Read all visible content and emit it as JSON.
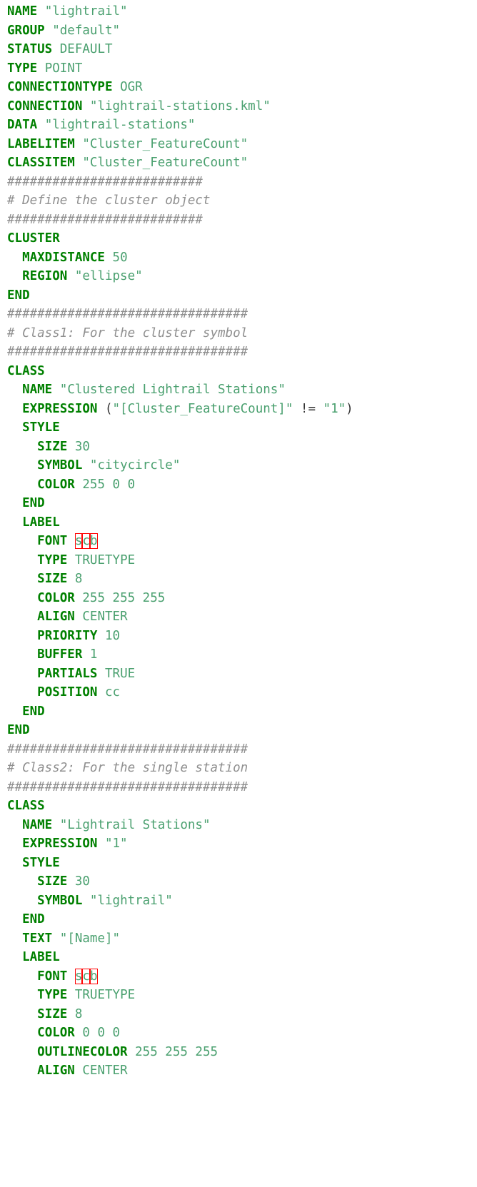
{
  "indent_unit": "  ",
  "lines": [
    {
      "indent": 0,
      "parts": [
        {
          "t": "NAME",
          "c": "kw"
        },
        {
          "t": " "
        },
        {
          "t": "\"lightrail\"",
          "c": "str"
        }
      ]
    },
    {
      "indent": 0,
      "parts": [
        {
          "t": "GROUP",
          "c": "kw"
        },
        {
          "t": " "
        },
        {
          "t": "\"default\"",
          "c": "str"
        }
      ]
    },
    {
      "indent": 0,
      "parts": [
        {
          "t": "STATUS",
          "c": "kw"
        },
        {
          "t": " "
        },
        {
          "t": "DEFAULT",
          "c": "val"
        }
      ]
    },
    {
      "indent": 0,
      "parts": [
        {
          "t": "TYPE",
          "c": "kw"
        },
        {
          "t": " "
        },
        {
          "t": "POINT",
          "c": "val"
        }
      ]
    },
    {
      "indent": 0,
      "parts": [
        {
          "t": "CONNECTIONTYPE",
          "c": "kw"
        },
        {
          "t": " "
        },
        {
          "t": "OGR",
          "c": "val"
        }
      ]
    },
    {
      "indent": 0,
      "parts": [
        {
          "t": "CONNECTION",
          "c": "kw"
        },
        {
          "t": " "
        },
        {
          "t": "\"lightrail-stations.kml\"",
          "c": "str"
        }
      ]
    },
    {
      "indent": 0,
      "parts": [
        {
          "t": "DATA",
          "c": "kw"
        },
        {
          "t": " "
        },
        {
          "t": "\"lightrail-stations\"",
          "c": "str"
        }
      ]
    },
    {
      "indent": 0,
      "parts": [
        {
          "t": "LABELITEM",
          "c": "kw"
        },
        {
          "t": " "
        },
        {
          "t": "\"Cluster_FeatureCount\"",
          "c": "str"
        }
      ]
    },
    {
      "indent": 0,
      "parts": [
        {
          "t": "CLASSITEM",
          "c": "kw"
        },
        {
          "t": " "
        },
        {
          "t": "\"Cluster_FeatureCount\"",
          "c": "str"
        }
      ]
    },
    {
      "indent": 0,
      "parts": [
        {
          "t": "##########################",
          "c": "cm"
        }
      ]
    },
    {
      "indent": 0,
      "parts": [
        {
          "t": "# Define the cluster object",
          "c": "cm"
        }
      ]
    },
    {
      "indent": 0,
      "parts": [
        {
          "t": "##########################",
          "c": "cm"
        }
      ]
    },
    {
      "indent": 0,
      "parts": [
        {
          "t": "CLUSTER",
          "c": "kw"
        }
      ]
    },
    {
      "indent": 1,
      "parts": [
        {
          "t": "MAXDISTANCE",
          "c": "kw"
        },
        {
          "t": " "
        },
        {
          "t": "50",
          "c": "val"
        }
      ]
    },
    {
      "indent": 1,
      "parts": [
        {
          "t": "REGION",
          "c": "kw"
        },
        {
          "t": " "
        },
        {
          "t": "\"ellipse\"",
          "c": "str"
        }
      ]
    },
    {
      "indent": 0,
      "parts": [
        {
          "t": "END",
          "c": "kw"
        }
      ]
    },
    {
      "indent": 0,
      "parts": [
        {
          "t": "################################",
          "c": "cm"
        }
      ]
    },
    {
      "indent": 0,
      "parts": [
        {
          "t": "# Class1: For the cluster symbol",
          "c": "cm"
        }
      ]
    },
    {
      "indent": 0,
      "parts": [
        {
          "t": "################################",
          "c": "cm"
        }
      ]
    },
    {
      "indent": 0,
      "parts": [
        {
          "t": "CLASS",
          "c": "kw"
        }
      ]
    },
    {
      "indent": 1,
      "parts": [
        {
          "t": "NAME",
          "c": "kw"
        },
        {
          "t": " "
        },
        {
          "t": "\"Clustered Lightrail Stations\"",
          "c": "str"
        }
      ]
    },
    {
      "indent": 1,
      "parts": [
        {
          "t": "EXPRESSION",
          "c": "kw"
        },
        {
          "t": " ("
        },
        {
          "t": "\"[Cluster_FeatureCount]\"",
          "c": "str"
        },
        {
          "t": " != "
        },
        {
          "t": "\"1\"",
          "c": "str"
        },
        {
          "t": ")"
        }
      ]
    },
    {
      "indent": 1,
      "parts": [
        {
          "t": "STYLE",
          "c": "kw"
        }
      ]
    },
    {
      "indent": 2,
      "parts": [
        {
          "t": "SIZE",
          "c": "kw"
        },
        {
          "t": " "
        },
        {
          "t": "30",
          "c": "val"
        }
      ]
    },
    {
      "indent": 2,
      "parts": [
        {
          "t": "SYMBOL",
          "c": "kw"
        },
        {
          "t": " "
        },
        {
          "t": "\"citycircle\"",
          "c": "str"
        }
      ]
    },
    {
      "indent": 2,
      "parts": [
        {
          "t": "COLOR",
          "c": "kw"
        },
        {
          "t": " "
        },
        {
          "t": "255 0 0",
          "c": "val"
        }
      ]
    },
    {
      "indent": 1,
      "parts": [
        {
          "t": "END",
          "c": "kw"
        }
      ]
    },
    {
      "indent": 1,
      "parts": [
        {
          "t": "LABEL",
          "c": "kw"
        }
      ]
    },
    {
      "indent": 2,
      "parts": [
        {
          "t": "FONT",
          "c": "kw"
        },
        {
          "t": " "
        },
        {
          "t": "s",
          "c": "err"
        },
        {
          "t": "c",
          "c": "err"
        },
        {
          "t": "b",
          "c": "err"
        }
      ]
    },
    {
      "indent": 2,
      "parts": [
        {
          "t": "TYPE",
          "c": "kw"
        },
        {
          "t": " "
        },
        {
          "t": "TRUETYPE",
          "c": "val"
        }
      ]
    },
    {
      "indent": 2,
      "parts": [
        {
          "t": "SIZE",
          "c": "kw"
        },
        {
          "t": " "
        },
        {
          "t": "8",
          "c": "val"
        }
      ]
    },
    {
      "indent": 2,
      "parts": [
        {
          "t": "COLOR",
          "c": "kw"
        },
        {
          "t": " "
        },
        {
          "t": "255 255 255",
          "c": "val"
        }
      ]
    },
    {
      "indent": 2,
      "parts": [
        {
          "t": "ALIGN",
          "c": "kw"
        },
        {
          "t": " "
        },
        {
          "t": "CENTER",
          "c": "val"
        }
      ]
    },
    {
      "indent": 2,
      "parts": [
        {
          "t": "PRIORITY",
          "c": "kw"
        },
        {
          "t": " "
        },
        {
          "t": "10",
          "c": "val"
        }
      ]
    },
    {
      "indent": 2,
      "parts": [
        {
          "t": "BUFFER",
          "c": "kw"
        },
        {
          "t": " "
        },
        {
          "t": "1",
          "c": "val"
        }
      ]
    },
    {
      "indent": 2,
      "parts": [
        {
          "t": "PARTIALS",
          "c": "kw"
        },
        {
          "t": " "
        },
        {
          "t": "TRUE",
          "c": "val"
        }
      ]
    },
    {
      "indent": 2,
      "parts": [
        {
          "t": "POSITION",
          "c": "kw"
        },
        {
          "t": " "
        },
        {
          "t": "cc",
          "c": "val"
        }
      ]
    },
    {
      "indent": 1,
      "parts": [
        {
          "t": "END",
          "c": "kw"
        }
      ]
    },
    {
      "indent": 0,
      "parts": [
        {
          "t": "END",
          "c": "kw"
        }
      ]
    },
    {
      "indent": 0,
      "parts": [
        {
          "t": "################################",
          "c": "cm"
        }
      ]
    },
    {
      "indent": 0,
      "parts": [
        {
          "t": "# Class2: For the single station",
          "c": "cm"
        }
      ]
    },
    {
      "indent": 0,
      "parts": [
        {
          "t": "################################",
          "c": "cm"
        }
      ]
    },
    {
      "indent": 0,
      "parts": [
        {
          "t": "CLASS",
          "c": "kw"
        }
      ]
    },
    {
      "indent": 1,
      "parts": [
        {
          "t": "NAME",
          "c": "kw"
        },
        {
          "t": " "
        },
        {
          "t": "\"Lightrail Stations\"",
          "c": "str"
        }
      ]
    },
    {
      "indent": 1,
      "parts": [
        {
          "t": "EXPRESSION",
          "c": "kw"
        },
        {
          "t": " "
        },
        {
          "t": "\"1\"",
          "c": "str"
        }
      ]
    },
    {
      "indent": 1,
      "parts": [
        {
          "t": "STYLE",
          "c": "kw"
        }
      ]
    },
    {
      "indent": 2,
      "parts": [
        {
          "t": "SIZE",
          "c": "kw"
        },
        {
          "t": " "
        },
        {
          "t": "30",
          "c": "val"
        }
      ]
    },
    {
      "indent": 2,
      "parts": [
        {
          "t": "SYMBOL",
          "c": "kw"
        },
        {
          "t": " "
        },
        {
          "t": "\"lightrail\"",
          "c": "str"
        }
      ]
    },
    {
      "indent": 1,
      "parts": [
        {
          "t": "END",
          "c": "kw"
        }
      ]
    },
    {
      "indent": 1,
      "parts": [
        {
          "t": "TEXT",
          "c": "kw"
        },
        {
          "t": " "
        },
        {
          "t": "\"[Name]\"",
          "c": "str"
        }
      ]
    },
    {
      "indent": 1,
      "parts": [
        {
          "t": "LABEL",
          "c": "kw"
        }
      ]
    },
    {
      "indent": 2,
      "parts": [
        {
          "t": "FONT",
          "c": "kw"
        },
        {
          "t": " "
        },
        {
          "t": "s",
          "c": "err"
        },
        {
          "t": "c",
          "c": "err"
        },
        {
          "t": "b",
          "c": "err"
        }
      ]
    },
    {
      "indent": 2,
      "parts": [
        {
          "t": "TYPE",
          "c": "kw"
        },
        {
          "t": " "
        },
        {
          "t": "TRUETYPE",
          "c": "val"
        }
      ]
    },
    {
      "indent": 2,
      "parts": [
        {
          "t": "SIZE",
          "c": "kw"
        },
        {
          "t": " "
        },
        {
          "t": "8",
          "c": "val"
        }
      ]
    },
    {
      "indent": 2,
      "parts": [
        {
          "t": "COLOR",
          "c": "kw"
        },
        {
          "t": " "
        },
        {
          "t": "0 0 0",
          "c": "val"
        }
      ]
    },
    {
      "indent": 2,
      "parts": [
        {
          "t": "OUTLINECOLOR",
          "c": "kw"
        },
        {
          "t": " "
        },
        {
          "t": "255 255 255",
          "c": "val"
        }
      ]
    },
    {
      "indent": 2,
      "parts": [
        {
          "t": "ALIGN",
          "c": "kw"
        },
        {
          "t": " "
        },
        {
          "t": "CENTER",
          "c": "val"
        }
      ]
    }
  ]
}
